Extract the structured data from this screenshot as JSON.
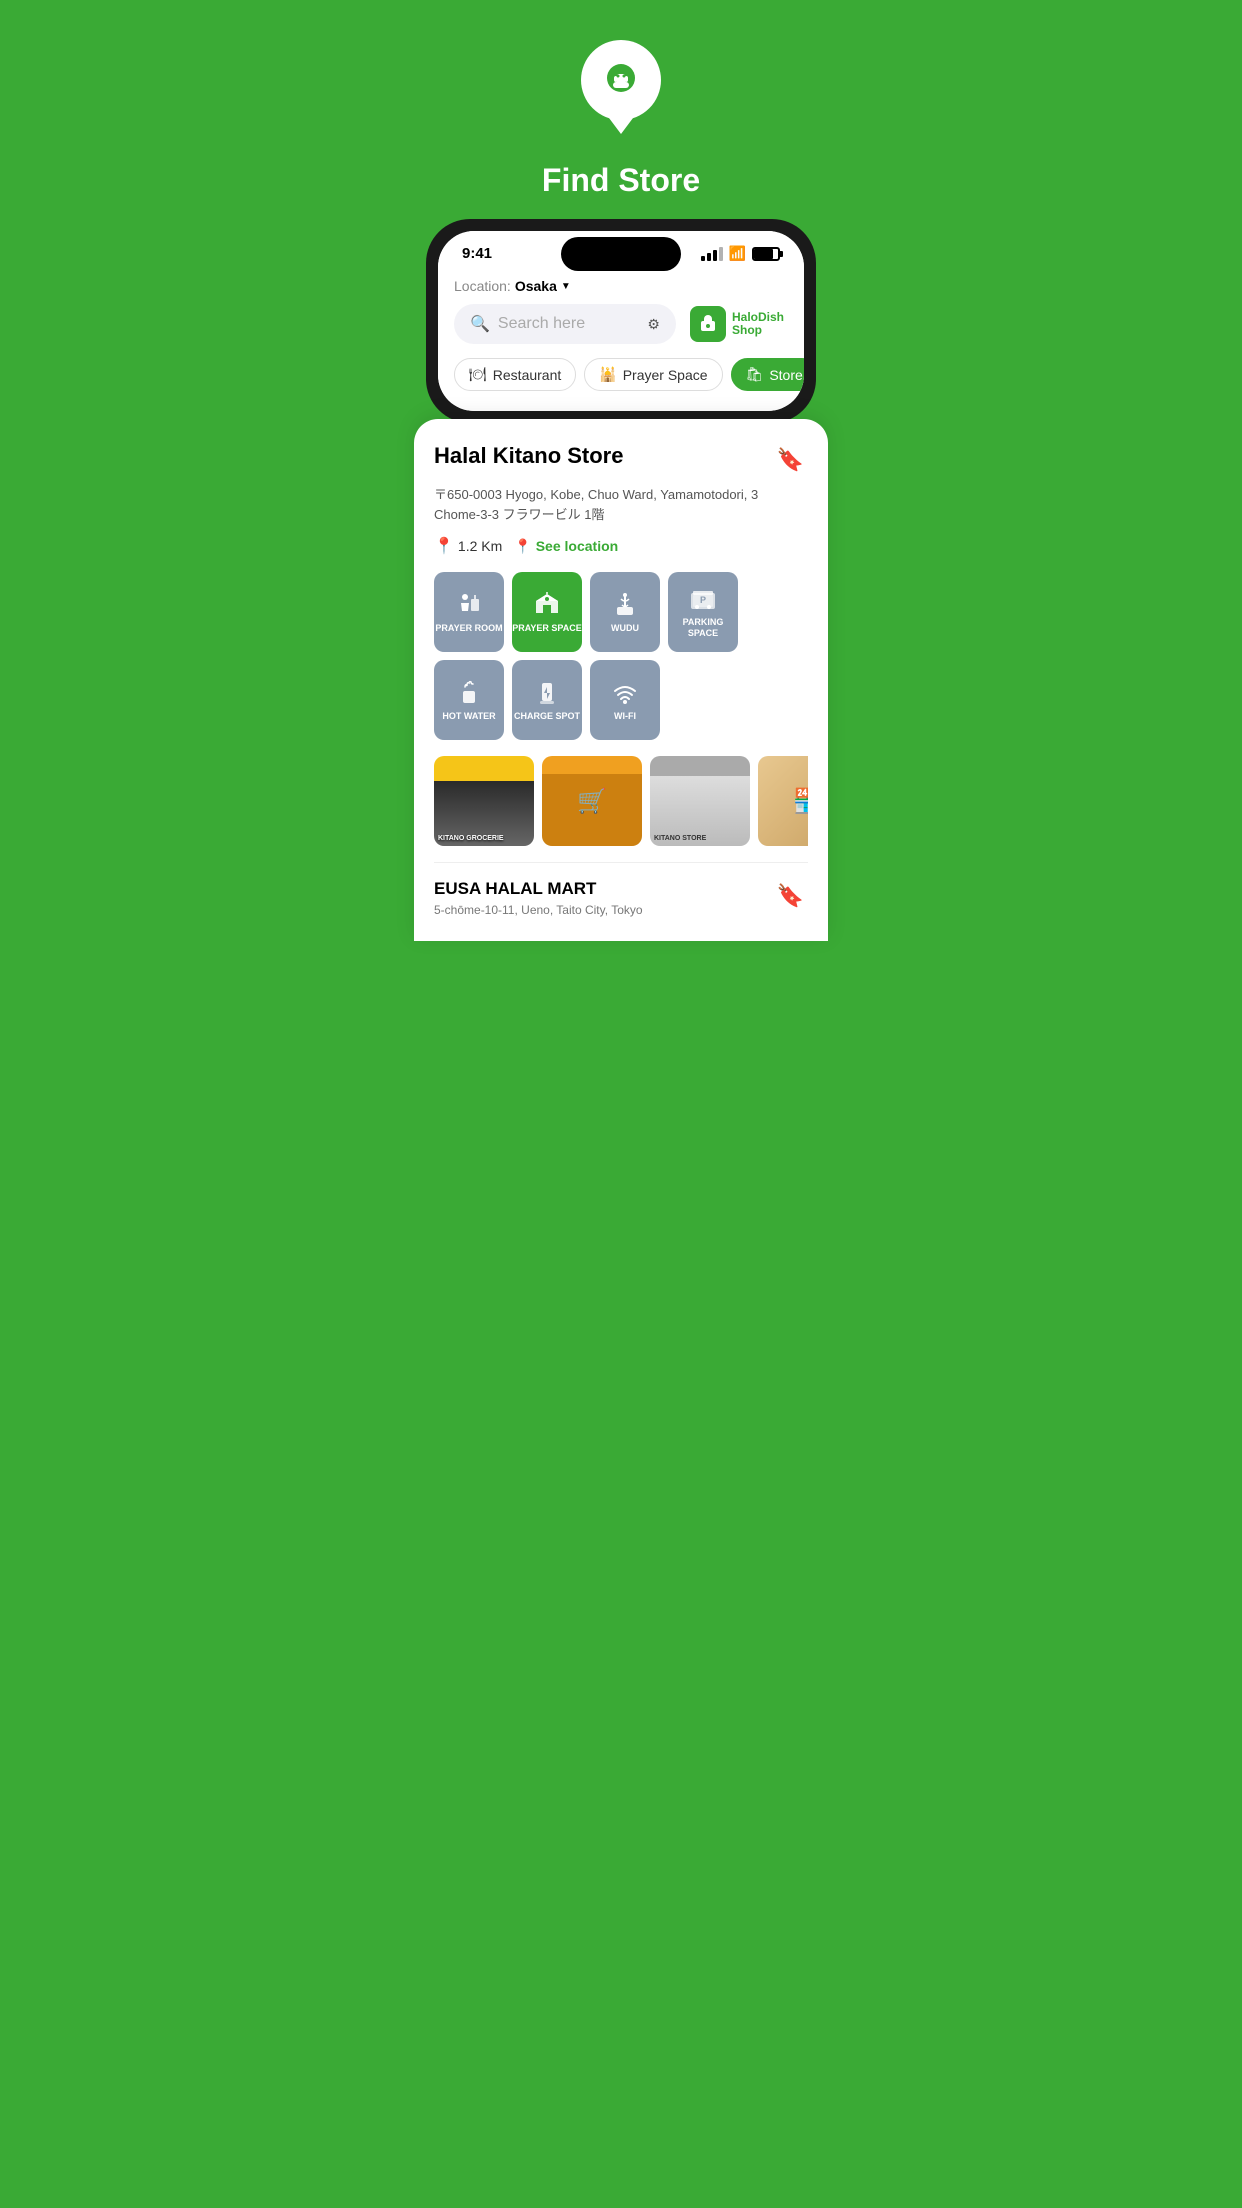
{
  "app": {
    "title": "Find Store",
    "background_color": "#3aaa35"
  },
  "status_bar": {
    "time": "9:41",
    "signal": "signal",
    "wifi": "wifi",
    "battery": "battery"
  },
  "header": {
    "location_label": "Location:",
    "location_city": "Osaka",
    "search_placeholder": "Search here",
    "halodish_name": "HaloDish",
    "halodish_sub": "Shop"
  },
  "categories": [
    {
      "id": "restaurant",
      "label": "Restaurant",
      "icon": "🍽",
      "active": false
    },
    {
      "id": "prayer-space",
      "label": "Prayer Space",
      "icon": "🕌",
      "active": false
    },
    {
      "id": "store",
      "label": "Store",
      "icon": "🛍",
      "active": true
    }
  ],
  "store": {
    "name": "Halal Kitano Store",
    "address": "〒650-0003 Hyogo, Kobe, Chuo Ward, Yamamotodori, 3 Chome-3-3 フラワービル 1階",
    "distance": "1.2 Km",
    "see_location": "See location",
    "bookmark_icon": "bookmark"
  },
  "amenities": [
    {
      "id": "prayer-room",
      "label": "PRAYER\nROOM",
      "active": false,
      "icon": "prayer-room"
    },
    {
      "id": "prayer-space",
      "label": "PRAYER\nSPACE",
      "active": true,
      "icon": "prayer-space"
    },
    {
      "id": "wudu",
      "label": "WUDU",
      "active": false,
      "icon": "wudu"
    },
    {
      "id": "parking-space",
      "label": "PARKING\nSPACE",
      "active": false,
      "icon": "parking"
    },
    {
      "id": "hot-water",
      "label": "HOT\nWATER",
      "active": false,
      "icon": "hot-water"
    },
    {
      "id": "charge-spot",
      "label": "CHARGE\nSPOT",
      "active": false,
      "icon": "charge"
    },
    {
      "id": "wifi",
      "label": "WI-FI",
      "active": false,
      "icon": "wifi"
    }
  ],
  "photos": [
    {
      "id": "photo-1",
      "alt": "Store front"
    },
    {
      "id": "photo-2",
      "alt": "Store interior shelves"
    },
    {
      "id": "photo-3",
      "alt": "Store entrance"
    },
    {
      "id": "photo-4",
      "alt": "Store interior"
    }
  ],
  "second_store": {
    "name": "EUSA HALAL MART",
    "address": "5-chōme-10-11, Ueno, Taito City, Tokyo",
    "bookmark_icon": "bookmark"
  }
}
